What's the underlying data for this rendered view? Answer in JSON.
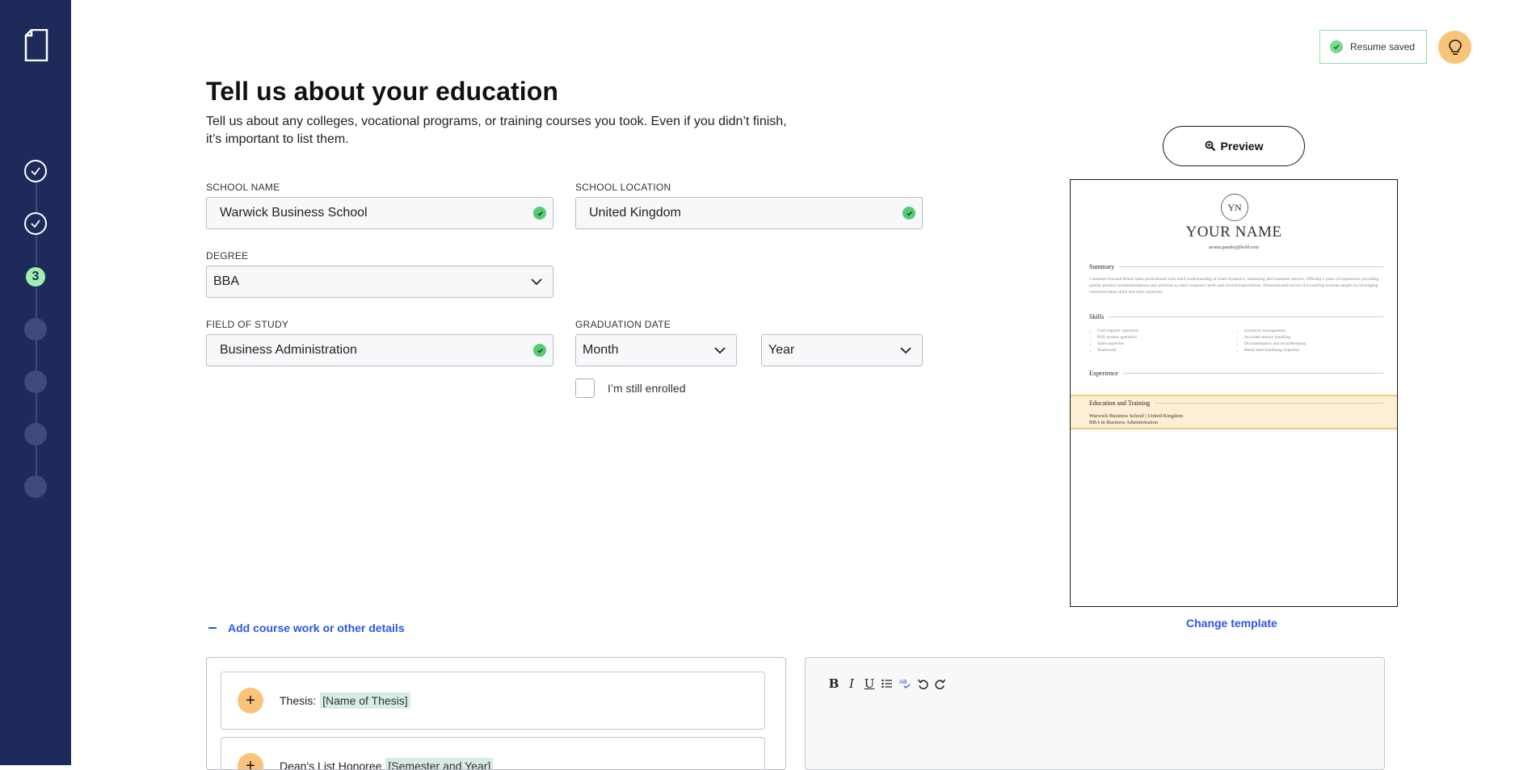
{
  "sidebar": {
    "steps": [
      {
        "state": "done",
        "label": ""
      },
      {
        "state": "done",
        "label": ""
      },
      {
        "state": "current",
        "label": "3"
      },
      {
        "state": "todo",
        "label": ""
      },
      {
        "state": "todo",
        "label": ""
      },
      {
        "state": "todo",
        "label": ""
      },
      {
        "state": "todo",
        "label": ""
      }
    ]
  },
  "header": {
    "saved_label": "Resume saved"
  },
  "page": {
    "title": "Tell us about your education",
    "subtitle": "Tell us about any colleges, vocational programs, or training courses you took. Even if you didn’t finish, it’s important to list them."
  },
  "form": {
    "school_name": {
      "label": "SCHOOL NAME",
      "value": "Warwick Business School"
    },
    "school_location": {
      "label": "SCHOOL LOCATION",
      "value": "United Kingdom"
    },
    "degree": {
      "label": "DEGREE",
      "value": "BBA"
    },
    "field_of_study": {
      "label": "FIELD OF STUDY",
      "value": "Business Administration"
    },
    "graduation": {
      "label": "GRADUATION DATE",
      "month": "Month",
      "year": "Year"
    },
    "enrolled_label": "I’m still enrolled"
  },
  "preview": {
    "button_label": "Preview",
    "change_template": "Change template",
    "resume": {
      "monogram": "YN",
      "name": "YOUR NAME",
      "email": "aroma.pandey@bold.com",
      "summary_title": "Summary",
      "summary_text": "Customer-focused Retail Sales professional with solid understanding of retail dynamics, marketing and customer service. Offering 5 years of experience providing quality product recommendations and solutions to meet customer needs and exceed expectations. Demonstrated record of exceeding revenue targets by leveraging communication skills and sales expertise.",
      "skills_title": "Skills",
      "skills_left": [
        "Cash register operation",
        "POS system operation",
        "Sales expertise",
        "Teamwork"
      ],
      "skills_right": [
        "Inventory management",
        "Accurate money handling",
        "Documentation and recordkeeping",
        "Retail merchandising expertise"
      ],
      "experience_title": "Experience",
      "education_title": "Education and Training",
      "education_line1": "Warwick Business School | United Kingdom",
      "education_line2": "BBA in Business Administration"
    }
  },
  "extras": {
    "add_link": "Add course work or other details",
    "suggestions": [
      {
        "prefix": "Thesis:",
        "placeholder": "[Name of Thesis]"
      },
      {
        "prefix": "Dean's List Honoree",
        "placeholder": "[Semester and Year]"
      }
    ]
  },
  "editor": {
    "tools": [
      "bold-icon",
      "italic-icon",
      "underline-icon",
      "bullet-list-icon",
      "spellcheck-icon",
      "undo-icon",
      "redo-icon"
    ]
  },
  "colors": {
    "sidebar_bg": "#1e2a5a",
    "accent_blue": "#2f55e8",
    "accent_orange": "#f9c47a",
    "success_green": "#55c973"
  }
}
